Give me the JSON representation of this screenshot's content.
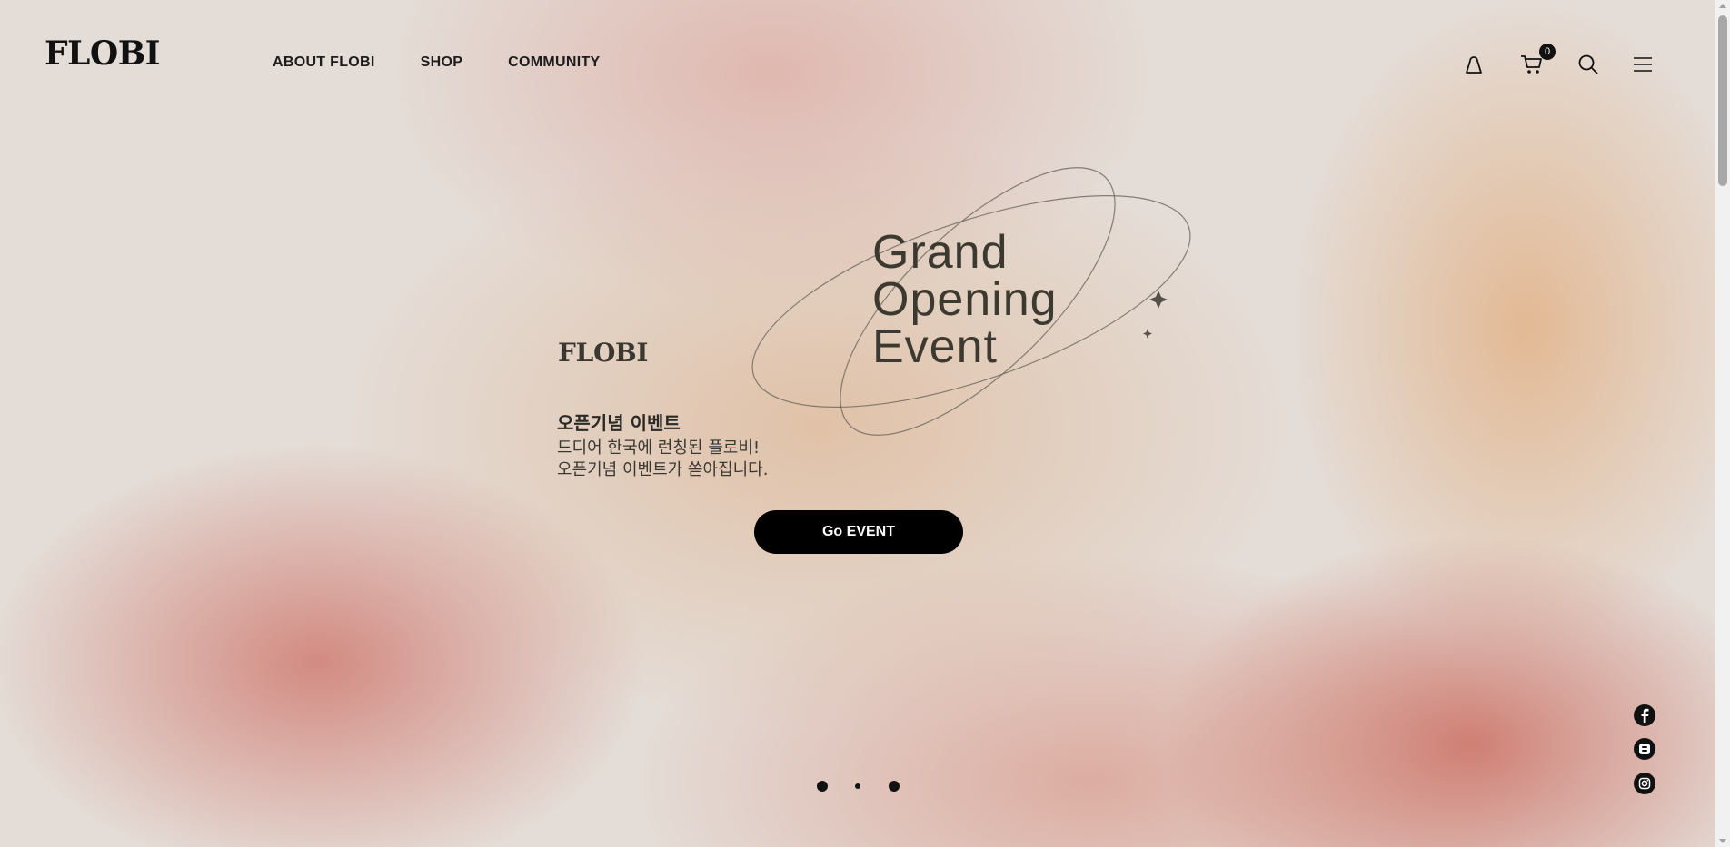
{
  "header": {
    "logo": "FLOBI",
    "nav": [
      {
        "label": "ABOUT FLOBI"
      },
      {
        "label": "SHOP"
      },
      {
        "label": "COMMUNITY"
      }
    ],
    "cart_count": "0",
    "icons": [
      "user-icon",
      "cart-icon",
      "search-icon",
      "menu-icon"
    ]
  },
  "hero": {
    "title_lines": [
      "Grand",
      "Opening",
      "Event"
    ],
    "brand": "FLOBI",
    "heading": "오픈기념 이벤트",
    "desc_lines": [
      "드디어 한국에 런칭된 플로비!",
      "오픈기념 이벤트가 쏟아집니다."
    ],
    "button_label": "Go EVENT"
  },
  "slider": {
    "slide_count": 3,
    "active_index": 1
  },
  "social": [
    "facebook-icon",
    "blog-icon",
    "instagram-icon"
  ],
  "colors": {
    "text_dark": "#111111",
    "hero_text": "#3c3a30",
    "button_bg": "#000000",
    "button_text": "#ffffff"
  }
}
